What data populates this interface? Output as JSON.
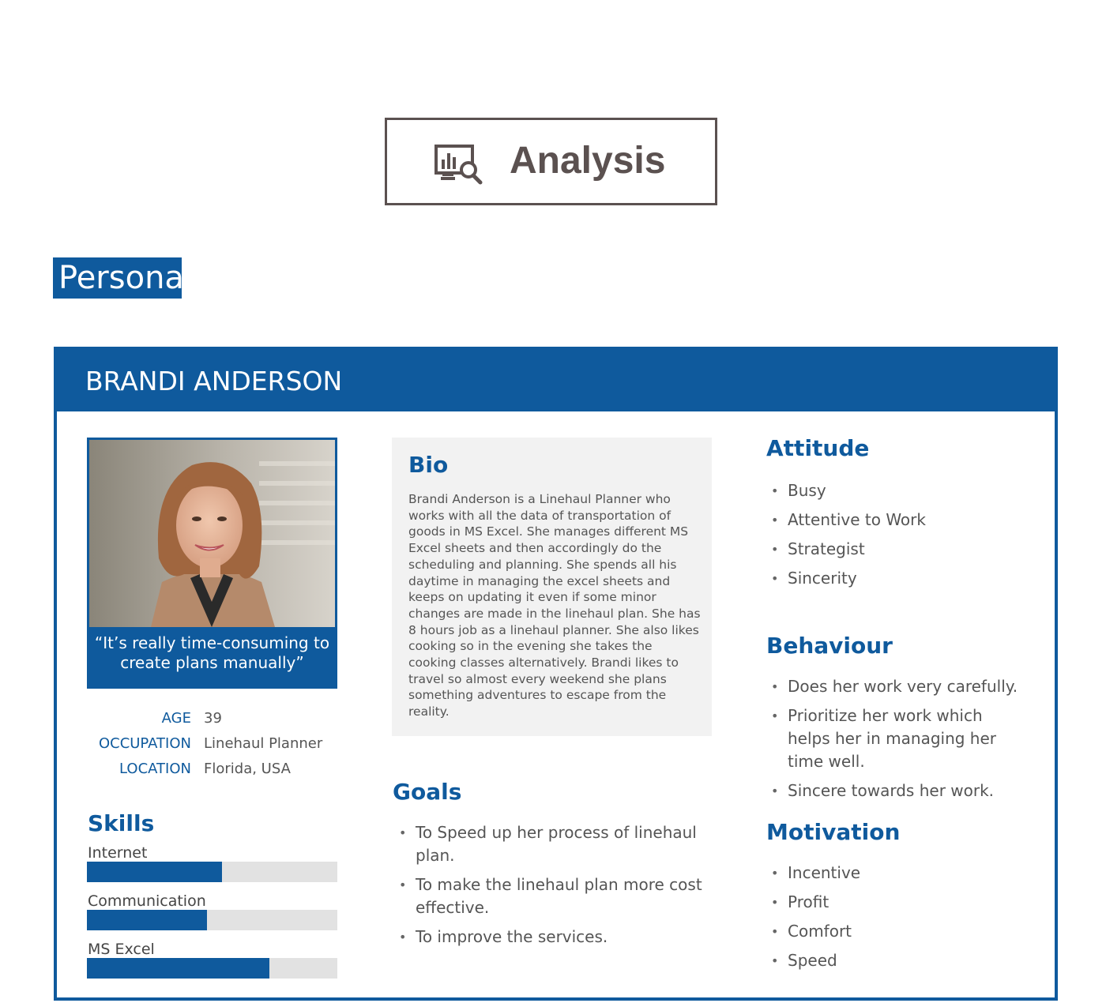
{
  "header": {
    "title": "Analysis",
    "icon": "chart-magnifier-icon"
  },
  "section_tag": "Persona",
  "persona": {
    "name": "BRANDI ANDERSON",
    "quote_line1": "“It’s really time-consuming to",
    "quote_line2": "create plans manually”",
    "info": [
      {
        "label": "AGE",
        "value": "39"
      },
      {
        "label": "OCCUPATION",
        "value": "Linehaul Planner"
      },
      {
        "label": "LOCATION",
        "value": "Florida, USA"
      }
    ],
    "skills_title": "Skills",
    "skills": [
      {
        "label": "Internet",
        "level": 0.54
      },
      {
        "label": "Communication",
        "level": 0.48
      },
      {
        "label": "MS Excel",
        "level": 0.73
      }
    ],
    "bio_title": "Bio",
    "bio": "Brandi Anderson is a Linehaul Planner who works with all the data of transportation of goods in MS Excel. She manages different MS Excel sheets and then accordingly do the scheduling and planning. She spends all his daytime in managing the excel sheets and keeps on updating it even if some minor changes are made in the linehaul plan. She has 8 hours job as a linehaul planner. She also likes cooking so in the evening she takes the cooking classes alternatively. Brandi likes to travel so almost every weekend she plans something adventures to escape from the reality.",
    "goals_title": "Goals",
    "goals": [
      "To Speed up her process of linehaul plan.",
      "To make the linehaul plan more cost effective.",
      "To improve the services."
    ],
    "attitude_title": "Attitude",
    "attitude": [
      "Busy",
      "Attentive to Work",
      "Strategist",
      "Sincerity"
    ],
    "behaviour_title": "Behaviour",
    "behaviour": [
      "Does her work very carefully.",
      "Prioritize her work which helps her in managing her time well.",
      "Sincere towards her work."
    ],
    "motivation_title": "Motivation",
    "motivation": [
      "Incentive",
      "Profit",
      "Comfort",
      "Speed"
    ]
  },
  "colors": {
    "brand": "#0f5a9d",
    "track": "#e2e2e2",
    "bio_bg": "#f2f2f2",
    "header_box": "#5b5150"
  }
}
